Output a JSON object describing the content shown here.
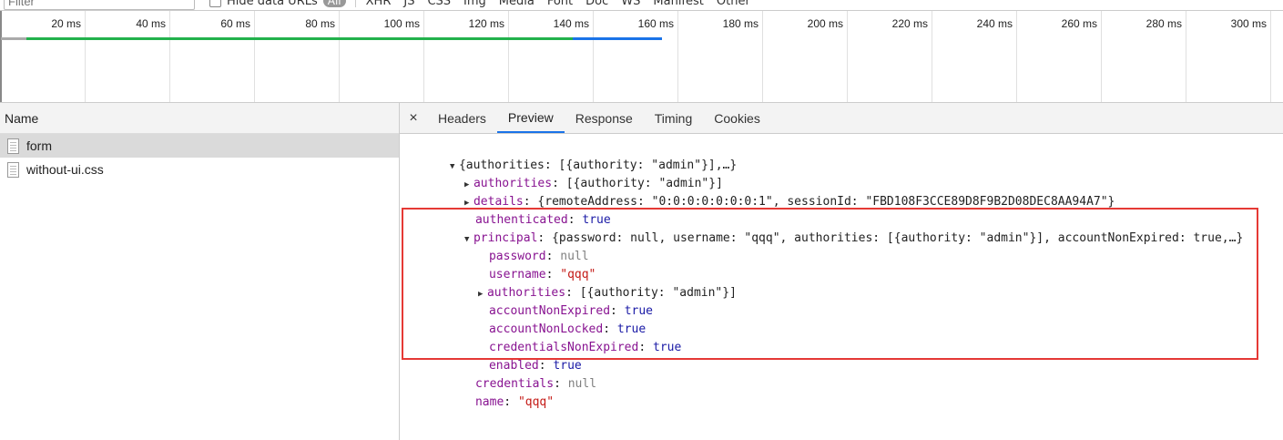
{
  "filter_bar": {
    "filter_placeholder": "Filter",
    "hide_data_urls_label": "Hide data URLs",
    "all_label": "All",
    "types": [
      "XHR",
      "JS",
      "CSS",
      "Img",
      "Media",
      "Font",
      "Doc",
      "WS",
      "Manifest",
      "Other"
    ]
  },
  "timeline": {
    "ticks": [
      "20 ms",
      "40 ms",
      "60 ms",
      "80 ms",
      "100 ms",
      "120 ms",
      "140 ms",
      "160 ms",
      "180 ms",
      "200 ms",
      "220 ms",
      "240 ms",
      "260 ms",
      "280 ms",
      "300 ms"
    ]
  },
  "name_panel": {
    "header": "Name",
    "requests": [
      {
        "name": "form",
        "selected": true
      },
      {
        "name": "without-ui.css",
        "selected": false
      }
    ]
  },
  "detail": {
    "close_glyph": "×",
    "tabs": [
      "Headers",
      "Preview",
      "Response",
      "Timing",
      "Cookies"
    ],
    "active_tab": "Preview"
  },
  "preview": {
    "root_summary": "{authorities: [{authority: \"admin\"}],…}",
    "authorities_key": "authorities",
    "authorities_value": "[{authority: \"admin\"}]",
    "details_key": "details",
    "details_value": "{remoteAddress: \"0:0:0:0:0:0:0:1\", sessionId: \"FBD108F3CCE89D8F9B2D08DEC8AA94A7\"}",
    "authenticated_key": "authenticated",
    "authenticated_value": "true",
    "principal_key": "principal",
    "principal_value": "{password: null, username: \"qqq\", authorities: [{authority: \"admin\"}], accountNonExpired: true,…}",
    "principal_fields": {
      "password_key": "password",
      "password_value": "null",
      "username_key": "username",
      "username_value": "\"qqq\"",
      "authorities_key": "authorities",
      "authorities_value": "[{authority: \"admin\"}]",
      "accountNonExpired_key": "accountNonExpired",
      "accountNonExpired_value": "true",
      "accountNonLocked_key": "accountNonLocked",
      "accountNonLocked_value": "true",
      "credentialsNonExpired_key": "credentialsNonExpired",
      "credentialsNonExpired_value": "true",
      "enabled_key": "enabled",
      "enabled_value": "true"
    },
    "credentials_key": "credentials",
    "credentials_value": "null",
    "name_key": "name",
    "name_value": "\"qqq\""
  },
  "colors": {
    "highlight_box": "#e53935",
    "tab_active": "#1a73e8",
    "key": "#881391",
    "string": "#c41a16",
    "bool": "#1a1aa6",
    "null": "#808080"
  }
}
